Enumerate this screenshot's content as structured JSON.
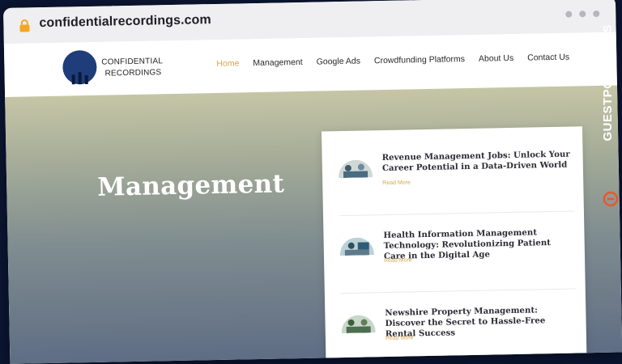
{
  "browser": {
    "url": "confidentialrecordings.com"
  },
  "site": {
    "logo_line1": "CONFIDENTIAL",
    "logo_line2": "RECORDINGS",
    "nav": [
      "Home",
      "Management",
      "Google Ads",
      "Crowdfunding Platforms",
      "About Us",
      "Contact Us"
    ],
    "active_nav": "Home"
  },
  "hero": {
    "title": "Management"
  },
  "posts": [
    {
      "title": "Revenue Management Jobs: Unlock Your Career Potential in a Data-Driven World",
      "read_more": "Read More"
    },
    {
      "title": "Health Information Management Technology: Revolutionizing Patient Care in the Digital Age",
      "read_more": "Read More"
    },
    {
      "title": "Newshire Property Management: Discover the Secret to Hassle-Free Rental Success",
      "read_more": "Read More"
    }
  ],
  "banner": {
    "text": "GUESTPOSTLINKS"
  },
  "colors": {
    "accent": "#d6a64a",
    "logo_bg": "#1f3d7a",
    "banner_accent": "#e8572c"
  }
}
